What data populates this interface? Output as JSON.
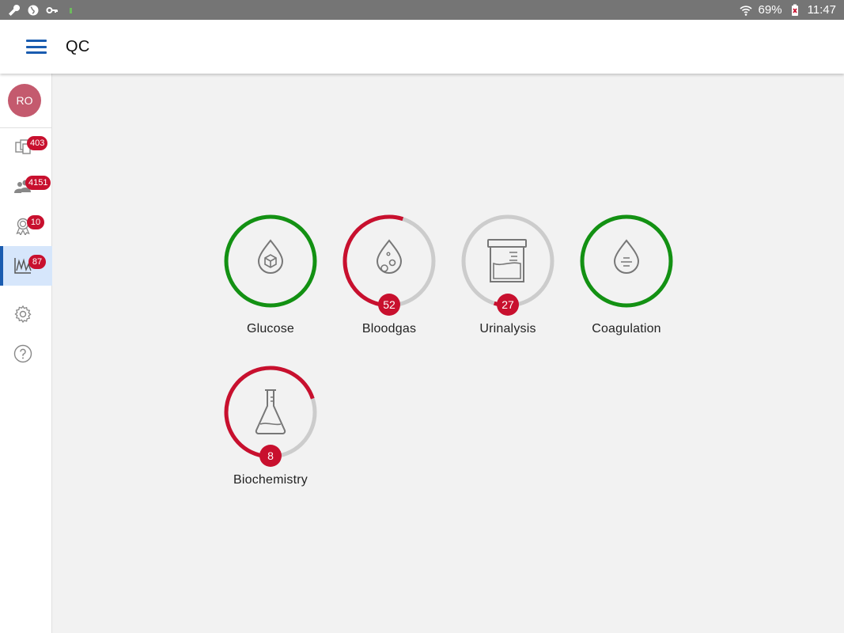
{
  "status_bar": {
    "battery": "69%",
    "time": "11:47"
  },
  "app_bar": {
    "title": "QC"
  },
  "sidebar": {
    "avatar_initials": "RO",
    "items": [
      {
        "icon": "documents-icon",
        "badge": "403"
      },
      {
        "icon": "people-icon",
        "badge": "4151"
      },
      {
        "icon": "certificate-icon",
        "badge": "10"
      },
      {
        "icon": "chart-icon",
        "badge": "87",
        "active": true
      },
      {
        "icon": "gear-icon"
      },
      {
        "icon": "help-icon"
      }
    ]
  },
  "tiles": [
    {
      "label": "Glucose",
      "count": "",
      "progress": 1.0,
      "status": "ok",
      "icon": "drop-cube-icon"
    },
    {
      "label": "Bloodgas",
      "count": "52",
      "progress": 0.55,
      "status": "warn",
      "icon": "drop-bubbles-icon"
    },
    {
      "label": "Urinalysis",
      "count": "27",
      "progress": 0.05,
      "status": "warn",
      "icon": "specimen-cup-icon"
    },
    {
      "label": "Coagulation",
      "count": "",
      "progress": 1.0,
      "status": "ok",
      "icon": "drop-lines-icon"
    },
    {
      "label": "Biochemistry",
      "count": "8",
      "progress": 0.7,
      "status": "warn",
      "icon": "flask-icon"
    }
  ],
  "colors": {
    "ok": "#139113",
    "warn": "#c8102e",
    "track": "#cccccc",
    "accent": "#1a5cb0"
  }
}
